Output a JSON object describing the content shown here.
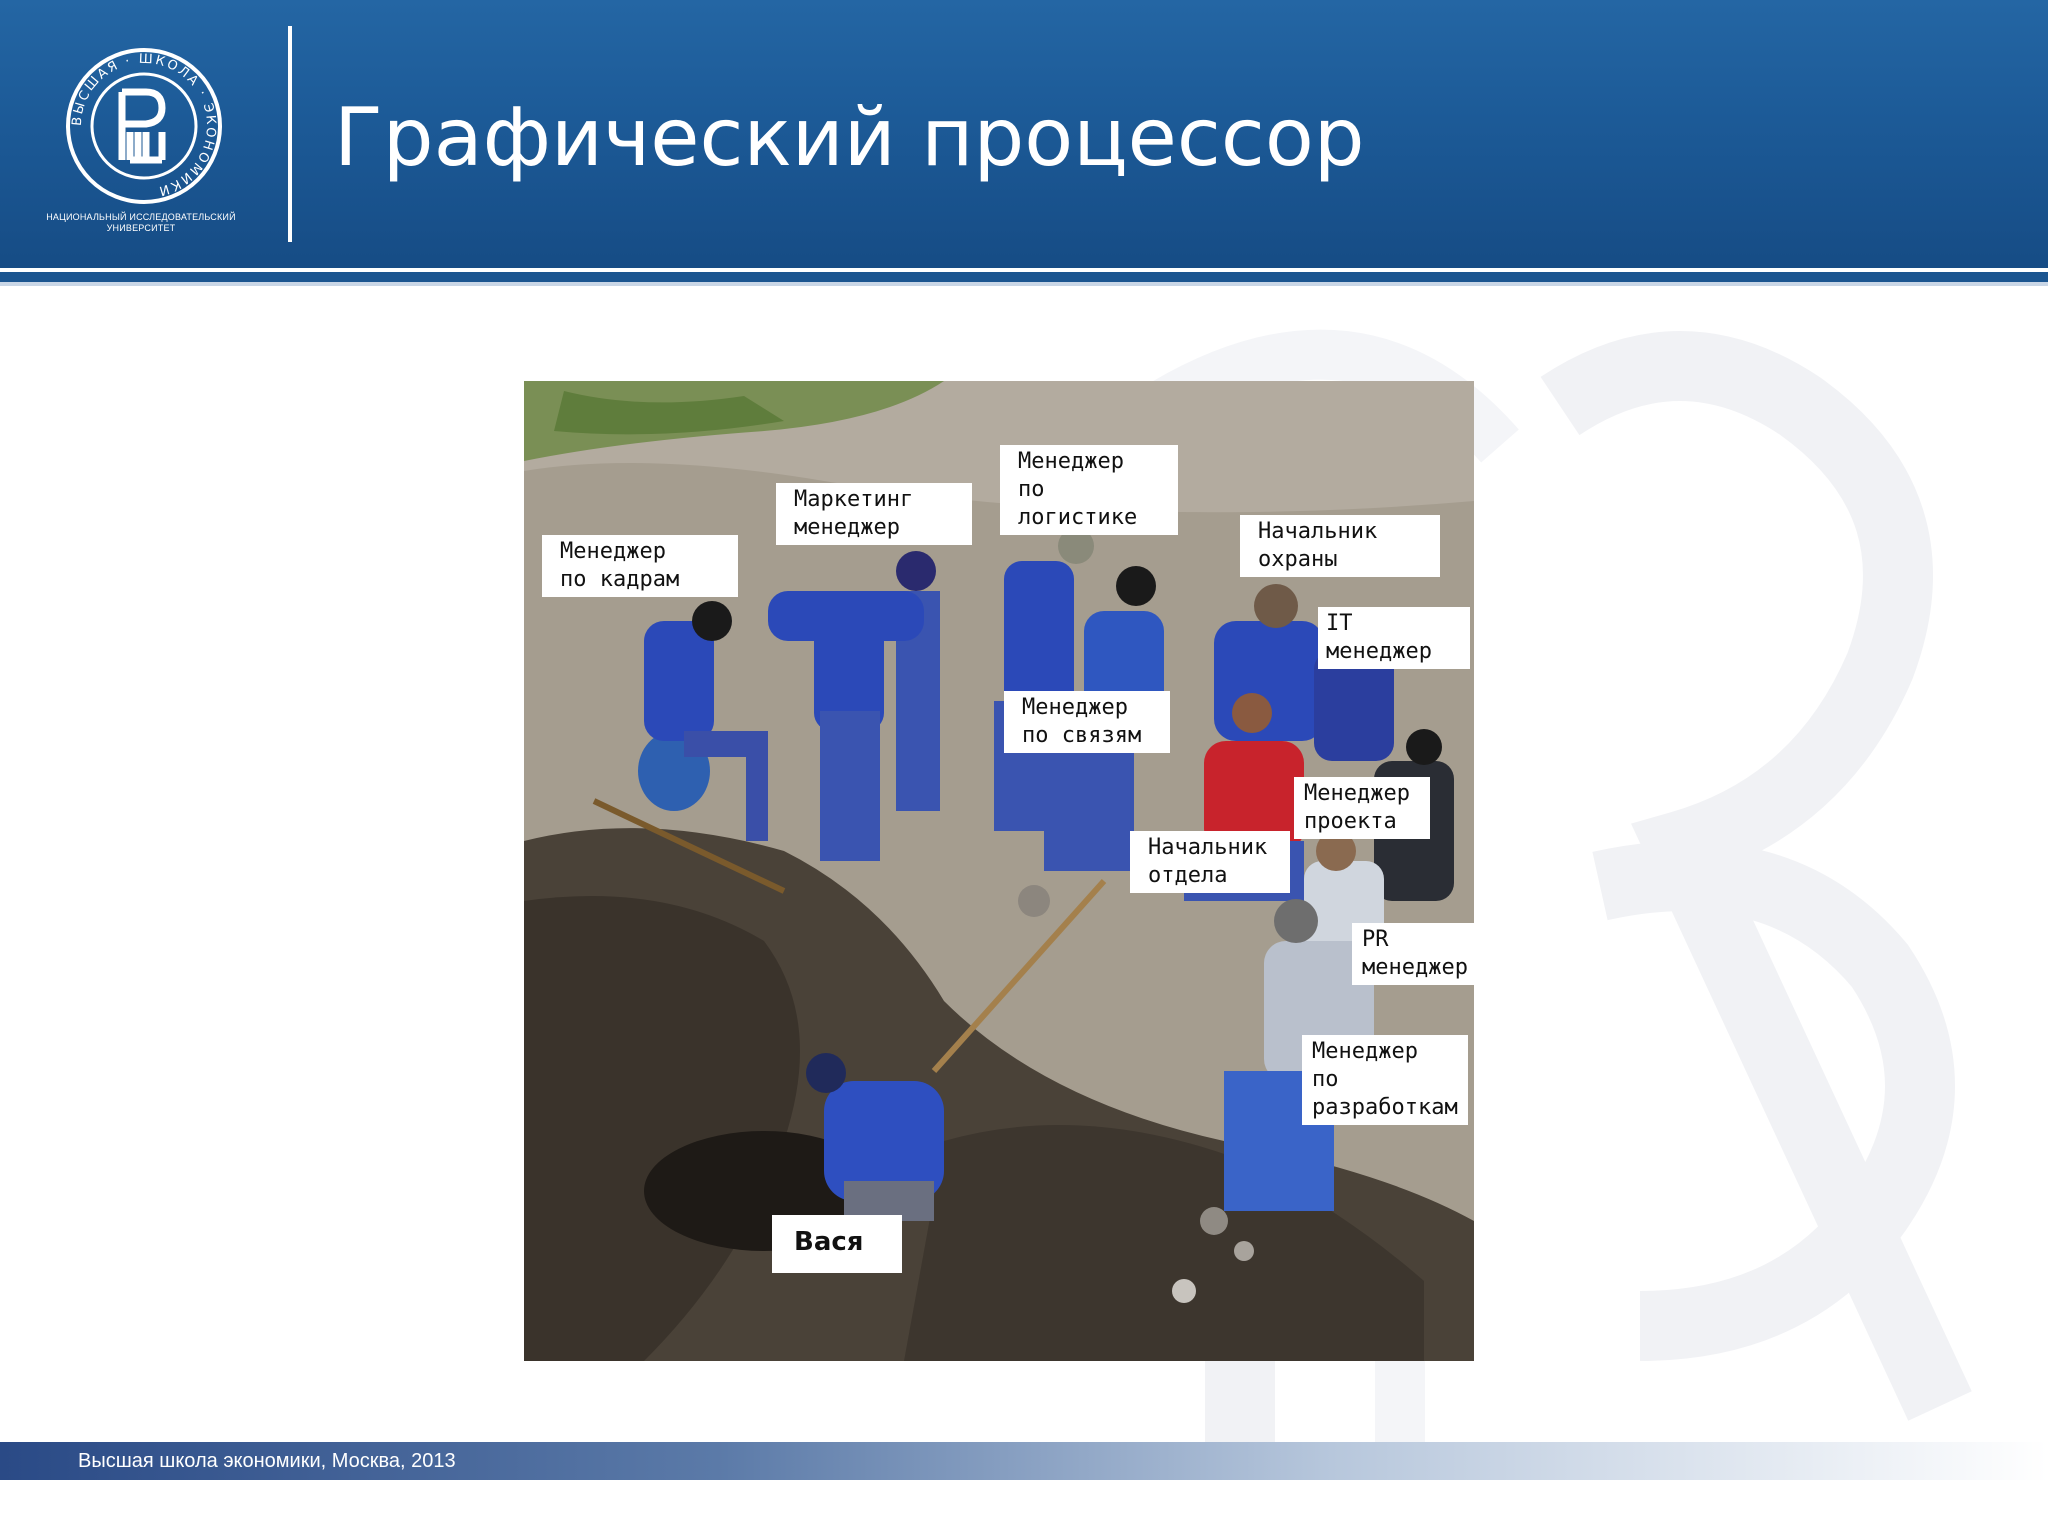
{
  "header": {
    "logo_caption_line1": "НАЦИОНАЛЬНЫЙ ИССЛЕДОВАТЕЛЬСКИЙ",
    "logo_caption_line2": "УНИВЕРСИТЕТ",
    "logo_ring_text": "ВЫСШАЯ · ШКОЛА · ЭКОНОМИКИ",
    "title": "Графический процессор"
  },
  "photo": {
    "labels": [
      {
        "id": "hr",
        "text": "Менеджер\nпо кадрам"
      },
      {
        "id": "marketing",
        "text": "Маркетинг\nменеджер"
      },
      {
        "id": "logistics",
        "text": "Менеджер\nпо логистике"
      },
      {
        "id": "security",
        "text": "Начальник\nохраны"
      },
      {
        "id": "it",
        "text": "IT менеджер"
      },
      {
        "id": "pr-relations",
        "text": "Менеджер\nпо связям"
      },
      {
        "id": "project",
        "text": "Менеджер\nпроекта"
      },
      {
        "id": "department",
        "text": "Начальник\nотдела"
      },
      {
        "id": "pr",
        "text": "PR\nменеджер"
      },
      {
        "id": "dev",
        "text": "Менеджер\nпо\nразработкам"
      },
      {
        "id": "vasya",
        "text": "Вася"
      }
    ]
  },
  "footer": {
    "text": "Высшая школа экономики, Москва, 2013"
  },
  "colors": {
    "header_blue": "#1c5a97",
    "footer_blue": "#2a4a86",
    "worker_blue": "#2b49b8"
  }
}
